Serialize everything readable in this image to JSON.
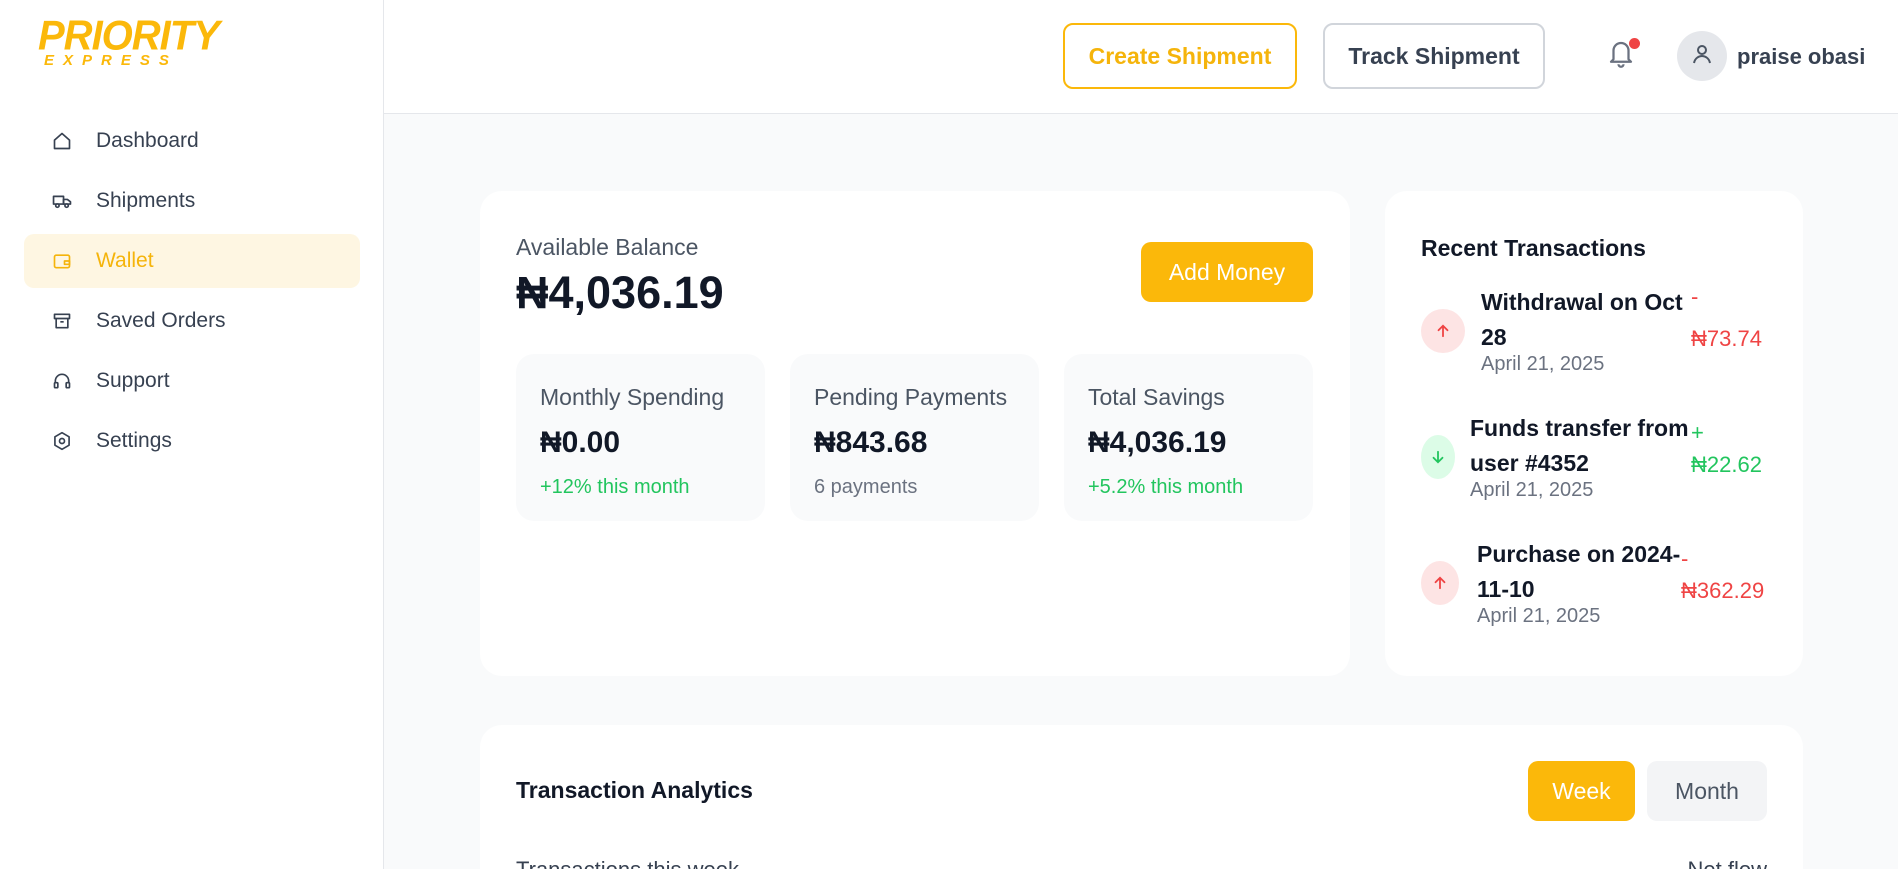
{
  "logo": {
    "line1": "PRIORITY",
    "line2": "EXPRESS"
  },
  "sidebar": {
    "items": [
      {
        "label": "Dashboard",
        "icon": "home-icon",
        "active": false
      },
      {
        "label": "Shipments",
        "icon": "truck-icon",
        "active": false
      },
      {
        "label": "Wallet",
        "icon": "wallet-icon",
        "active": true
      },
      {
        "label": "Saved Orders",
        "icon": "archive-icon",
        "active": false
      },
      {
        "label": "Support",
        "icon": "headphones-icon",
        "active": false
      },
      {
        "label": "Settings",
        "icon": "settings-icon",
        "active": false
      }
    ]
  },
  "header": {
    "create_label": "Create Shipment",
    "track_label": "Track Shipment",
    "username": "praise obasi"
  },
  "balance": {
    "label": "Available Balance",
    "value": "₦4,036.19",
    "add_label": "Add Money",
    "stats": [
      {
        "title": "Monthly Spending",
        "value": "₦0.00",
        "sub": "+12% this month",
        "sub_color": "green"
      },
      {
        "title": "Pending Payments",
        "value": "₦843.68",
        "sub": "6 payments",
        "sub_color": "gray"
      },
      {
        "title": "Total Savings",
        "value": "₦4,036.19",
        "sub": "+5.2% this month",
        "sub_color": "green"
      }
    ]
  },
  "recent": {
    "title": "Recent Transactions",
    "items": [
      {
        "name_line1": "Withdrawal on Oct",
        "name_line2": "28",
        "date": "April 21, 2025",
        "sign": "-",
        "amount": "₦73.74",
        "direction": "out"
      },
      {
        "name_line1": "Funds transfer from",
        "name_line2": "user #4352",
        "date": "April 21, 2025",
        "sign": "+",
        "amount": "₦22.62",
        "direction": "in"
      },
      {
        "name_line1": "Purchase on 2024-",
        "name_line2": "11-10",
        "date": "April 21, 2025",
        "sign": "-",
        "amount": "₦362.29",
        "direction": "out"
      }
    ]
  },
  "analytics": {
    "title": "Transaction Analytics",
    "week_label": "Week",
    "month_label": "Month",
    "cut_left": "Transactions this week",
    "cut_right": "Net flow"
  },
  "colors": {
    "accent": "#fbb80a",
    "positive": "#22c55e",
    "negative": "#ef4444"
  }
}
